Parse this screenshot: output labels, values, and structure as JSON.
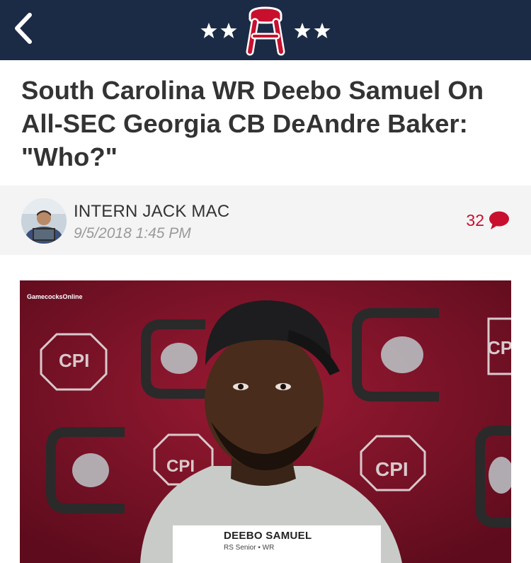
{
  "navbar": {
    "back_icon": "chevron-left-icon",
    "logo_icon": "barstool-logo-icon",
    "star_icon": "star-icon",
    "colors": {
      "background": "#1b2b45",
      "logo_red": "#c8102e"
    }
  },
  "article": {
    "headline": "South Carolina WR Deebo Samuel On All-SEC Georgia CB DeAndre Baker: \"Who?\"",
    "author": "INTERN JACK MAC",
    "date": "9/5/2018 1:45 PM",
    "comment_count": "32",
    "comment_icon": "speech-bubble-icon",
    "accent_color": "#c8102e"
  },
  "image": {
    "watermark": "GamecocksOnline",
    "lower_third": {
      "name": "DEEBO SAMUEL",
      "subtitle": "RS Senior • WR"
    }
  }
}
